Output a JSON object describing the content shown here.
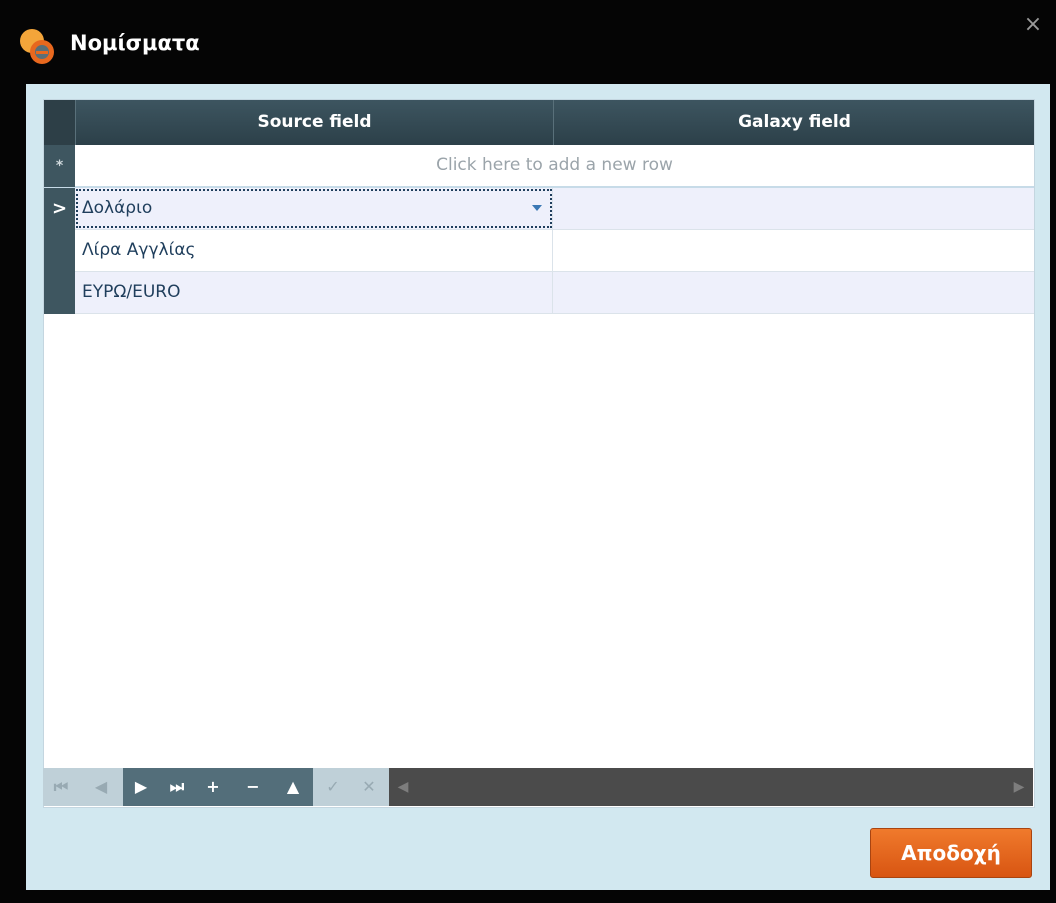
{
  "window": {
    "title": "Νομίσματα",
    "close_label": "×"
  },
  "grid": {
    "columns": [
      "Source field",
      "Galaxy field"
    ],
    "new_row_placeholder": "Click here to add a new row",
    "new_row_marker": "*",
    "current_row_marker": ">",
    "rows": [
      {
        "source": "Δολάριο",
        "galaxy": ""
      },
      {
        "source": "Λίρα Αγγλίας",
        "galaxy": ""
      },
      {
        "source": "ΕΥΡΩ/EURO",
        "galaxy": ""
      }
    ]
  },
  "navigator": {
    "first": "⏮",
    "prev": "◀",
    "next": "▶",
    "last": "⏭",
    "add": "+",
    "remove": "−",
    "edit": "▲",
    "save": "✓",
    "cancel": "✕",
    "scroll_left": "◀",
    "scroll_right": "▶"
  },
  "footer": {
    "accept_label": "Αποδοχή"
  },
  "colors": {
    "accent": "#e8681e",
    "header": "#2f444d",
    "client_bg": "#d2e8f0"
  }
}
